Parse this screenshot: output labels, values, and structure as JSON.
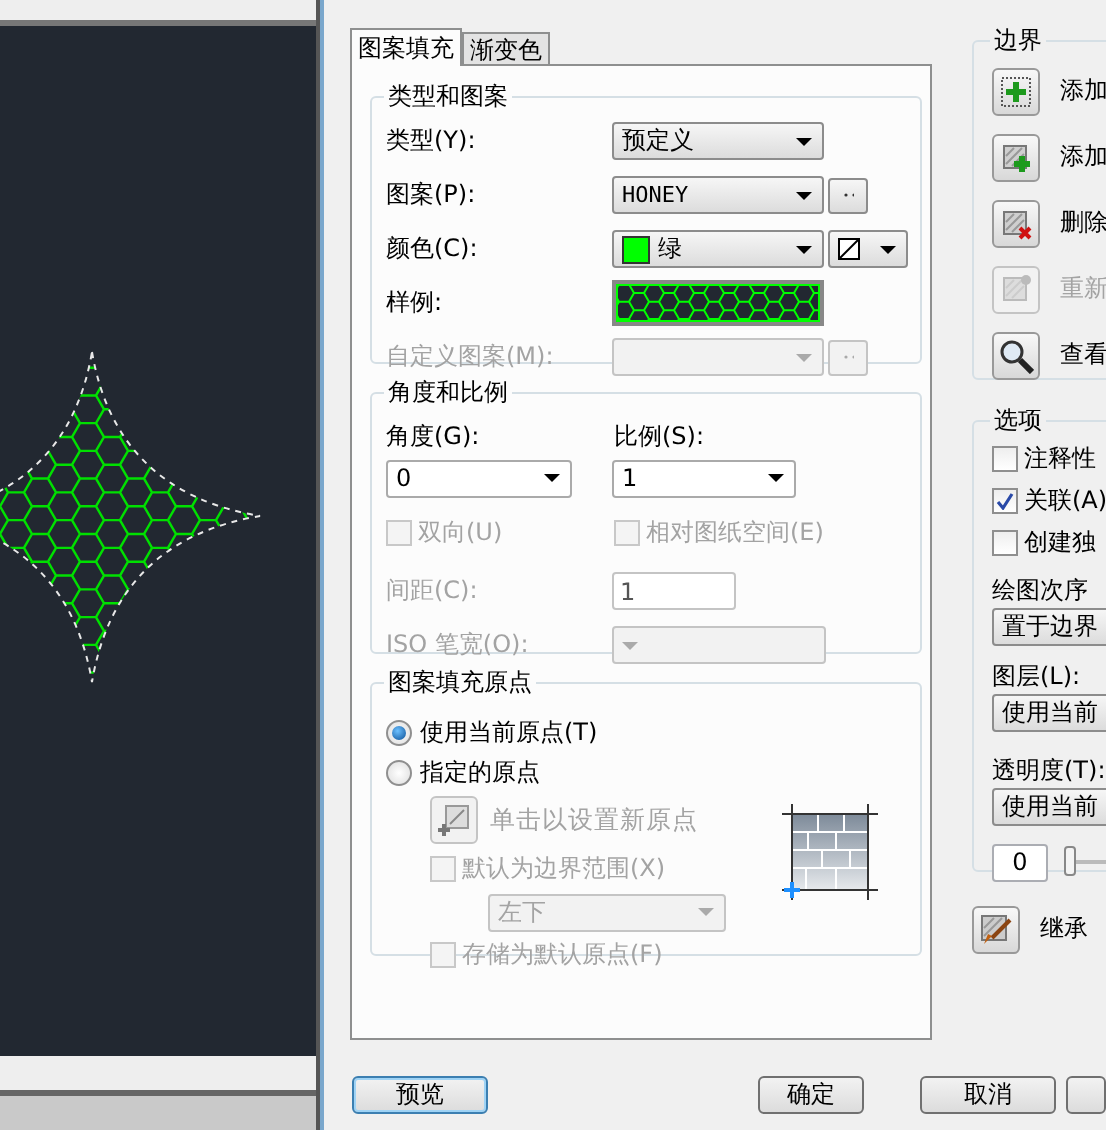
{
  "tabs": [
    {
      "label": "图案填充",
      "selected": true
    },
    {
      "label": "渐变色",
      "selected": false
    }
  ],
  "type_and_pattern": {
    "title": "类型和图案",
    "fields": [
      {
        "kind": "select",
        "label": "类型(Y):",
        "value": "预定义",
        "disabled": false
      },
      {
        "kind": "select-browse",
        "label": "图案(P):",
        "value": "HONEY",
        "disabled": false
      },
      {
        "kind": "color",
        "label": "颜色(C):",
        "value": "绿",
        "color": "#00ff00",
        "disabled": false
      },
      {
        "kind": "swatch",
        "label": "样例:",
        "disabled": false
      },
      {
        "kind": "select-browse",
        "label": "自定义图案(M):",
        "disabled": true
      }
    ]
  },
  "angle_and_scale": {
    "title": "角度和比例",
    "angle": {
      "label": "角度(G):",
      "value": "0"
    },
    "scale": {
      "label": "比例(S):",
      "value": "1"
    },
    "checkboxes": [
      {
        "label": "双向(U)",
        "checked": false,
        "disabled": true
      },
      {
        "label": "相对图纸空间(E)",
        "checked": false,
        "disabled": true
      }
    ],
    "spacing": {
      "label": "间距(C):",
      "value": "1",
      "disabled": true
    },
    "iso_pen_width": {
      "label": "ISO 笔宽(O):",
      "disabled": true
    }
  },
  "hatch_origin": {
    "title": "图案填充原点",
    "radios": [
      {
        "label": "使用当前原点(T)",
        "selected": true
      },
      {
        "label": "指定的原点",
        "selected": false
      }
    ],
    "click_button": {
      "label": "单击以设置新原点",
      "disabled": true
    },
    "default_extents": {
      "label": "默认为边界范围(X)",
      "checked": false,
      "disabled": true
    },
    "position": {
      "value": "左下",
      "disabled": true
    },
    "store_default": {
      "label": "存储为默认原点(F)",
      "checked": false,
      "disabled": true
    }
  },
  "boundaries": {
    "title": "边界",
    "buttons": [
      {
        "kind": "pick",
        "label": "添加",
        "disabled": false
      },
      {
        "kind": "select",
        "label": "添加",
        "disabled": false
      },
      {
        "kind": "remove",
        "label": "删除",
        "disabled": false
      },
      {
        "kind": "recreate",
        "label": "重新",
        "disabled": true
      },
      {
        "kind": "view",
        "label": "查看",
        "disabled": false
      }
    ]
  },
  "options": {
    "title": "选项",
    "checkboxes": [
      {
        "label": "注释性",
        "checked": false
      },
      {
        "label": "关联(A)",
        "checked": true
      },
      {
        "label": "创建独",
        "checked": false
      }
    ],
    "draw_order": {
      "label": "绘图次序",
      "value": "置于边界"
    },
    "layer": {
      "label": "图层(L):",
      "value": "使用当前"
    },
    "transparency": {
      "label": "透明度(T):",
      "value": "使用当前",
      "amount": "0",
      "level": 0
    }
  },
  "inherit": {
    "label": "继承"
  },
  "buttons": [
    {
      "label": "预览"
    },
    {
      "label": "确定"
    },
    {
      "label": "取消"
    }
  ]
}
